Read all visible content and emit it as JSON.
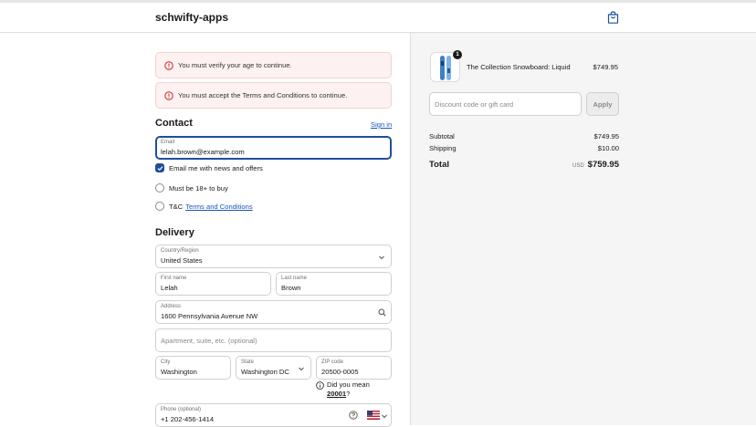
{
  "header": {
    "shop_name": "schwifty-apps",
    "cart_icon": "shopping-bag-icon"
  },
  "errors": [
    {
      "text": "You must verify your age to continue."
    },
    {
      "text": "You must accept the Terms and Conditions to continue."
    }
  ],
  "contact": {
    "title": "Contact",
    "signin_label": "Sign in",
    "email_label": "Email",
    "email_value": "lelah.brown@example.com",
    "news_label": "Email me with news and offers",
    "news_checked": true,
    "age_label": "Must be 18+ to buy",
    "tc_prefix": "T&C",
    "tc_link": "Terms and Conditions"
  },
  "delivery": {
    "title": "Delivery",
    "country_label": "Country/Region",
    "country_value": "United States",
    "first_name_label": "First name",
    "first_name_value": "Lelah",
    "last_name_label": "Last name",
    "last_name_value": "Brown",
    "address_label": "Address",
    "address_value": "1600 Pennsylvania Avenue NW",
    "apartment_placeholder": "Apartment, suite, etc. (optional)",
    "city_label": "City",
    "city_value": "Washington",
    "state_label": "State",
    "state_value": "Washington DC",
    "zip_label": "ZIP code",
    "zip_value": "20500-0005",
    "suggestion_prefix": "Did you mean",
    "suggestion_zip": "20001",
    "suggestion_suffix": "?",
    "phone_label": "Phone (optional)",
    "phone_value": "+1 202-456-1414"
  },
  "summary": {
    "item": {
      "name": "The Collection Snowboard: Liquid",
      "price": "$749.95",
      "quantity": "1"
    },
    "discount_placeholder": "Discount code or gift card",
    "apply_label": "Apply",
    "subtotal_label": "Subtotal",
    "subtotal_value": "$749.95",
    "shipping_label": "Shipping",
    "shipping_value": "$10.00",
    "total_label": "Total",
    "currency": "USD",
    "total_value": "$759.95"
  },
  "colors": {
    "accent": "#1f4f9c",
    "link": "#1a55b8",
    "error_bg": "#fdf1f1",
    "error_icon": "#c62828"
  }
}
